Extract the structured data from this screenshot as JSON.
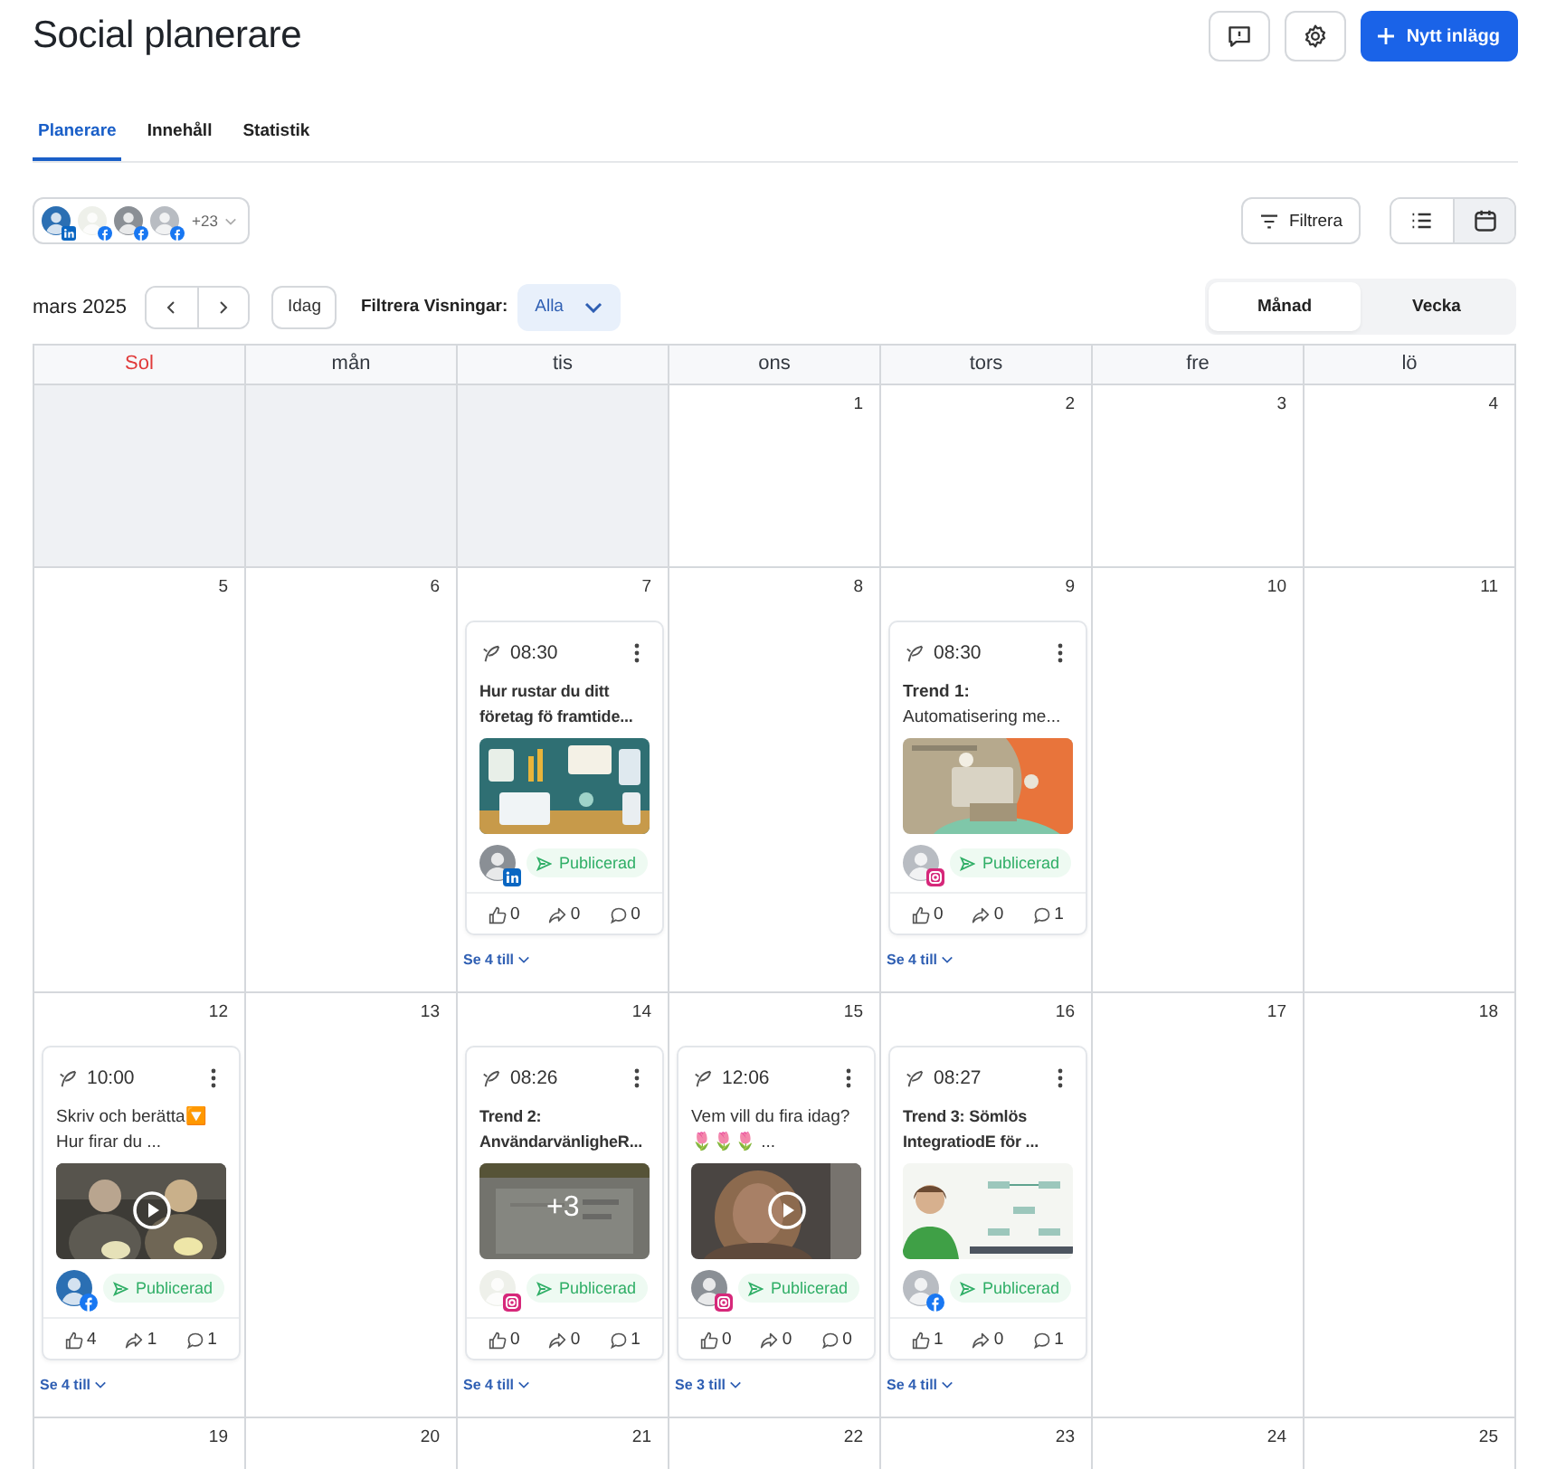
{
  "header": {
    "title": "Social planerare",
    "icon_buttons": [
      {
        "kind": "feedback"
      },
      {
        "kind": "settings"
      }
    ],
    "primary_button": "Nytt inlägg"
  },
  "tabs": [
    {
      "label": "Planerare",
      "selected": true
    },
    {
      "label": "Innehåll",
      "selected": false
    },
    {
      "label": "Statistik",
      "selected": false
    }
  ],
  "accounts": {
    "avatars": [
      {
        "kind": "linkedin"
      },
      {
        "kind": "facebook"
      },
      {
        "kind": "facebook"
      },
      {
        "kind": "facebook"
      }
    ],
    "more": "+23"
  },
  "filter_button": "Filtrera",
  "view_toggle": [
    {
      "kind": "list",
      "selected": false
    },
    {
      "kind": "calendar",
      "selected": true
    }
  ],
  "toolbar": {
    "month": "mars 2025",
    "today": "Idag",
    "filter_label": "Filtrera Visningar:",
    "filter_value": "Alla",
    "modes": [
      {
        "label": "Månad",
        "selected": true
      },
      {
        "label": "Vecka",
        "selected": false
      }
    ]
  },
  "weekdays": [
    {
      "label": "Sol",
      "color": "#e03a3a"
    },
    {
      "label": "mån",
      "color": "#333840"
    },
    {
      "label": "tis",
      "color": "#333840"
    },
    {
      "label": "ons",
      "color": "#333840"
    },
    {
      "label": "tors",
      "color": "#333840"
    },
    {
      "label": "fre",
      "color": "#333840"
    },
    {
      "label": "lö",
      "color": "#333840"
    }
  ],
  "weeks": [
    {
      "days": [
        {
          "outside": true
        },
        {
          "outside": true
        },
        {
          "outside": true
        },
        {
          "outside": false,
          "number": "1"
        },
        {
          "outside": false,
          "number": "2"
        },
        {
          "outside": false,
          "number": "3"
        },
        {
          "outside": false,
          "number": "4"
        }
      ]
    },
    {
      "days": [
        {
          "outside": false,
          "number": "5"
        },
        {
          "outside": false,
          "number": "6"
        },
        {
          "outside": false,
          "number": "7",
          "posts": [
            {
              "time": "08:30",
              "title": "Hur rustar du ditt företag fö framtide...",
              "bold": true,
              "kind": "linkedin",
              "status": "Publicerad",
              "likes": "0",
              "shares": "0",
              "comments": "0"
            }
          ],
          "more": "Se 4 till"
        },
        {
          "outside": false,
          "number": "8"
        },
        {
          "outside": false,
          "number": "9",
          "posts": [
            {
              "time": "08:30",
              "title": "**Trend 1:** Automatisering me...",
              "bold": false,
              "kind": "instagram",
              "status": "Publicerad",
              "likes": "0",
              "shares": "0",
              "comments": "1"
            }
          ],
          "more": "Se 4 till"
        },
        {
          "outside": false,
          "number": "10"
        },
        {
          "outside": false,
          "number": "11"
        }
      ]
    },
    {
      "days": [
        {
          "outside": false,
          "number": "12",
          "posts": [
            {
              "time": "10:00",
              "title": "Skriv och berätta🔽 Hur firar du ...",
              "bold": false,
              "media": {
                "kind": "video"
              },
              "kind": "facebook",
              "status": "Publicerad",
              "likes": "4",
              "shares": "1",
              "comments": "1"
            }
          ],
          "more": "Se 4 till"
        },
        {
          "outside": false,
          "number": "13"
        },
        {
          "outside": false,
          "number": "14",
          "posts": [
            {
              "time": "08:26",
              "title": "Trend 2: AnvändarvänligheR...",
              "bold": true,
              "media": {
                "overlay": "+3"
              },
              "kind": "instagram",
              "status": "Publicerad",
              "likes": "0",
              "shares": "0",
              "comments": "1"
            }
          ],
          "more": "Se 4 till"
        },
        {
          "outside": false,
          "number": "15",
          "posts": [
            {
              "time": "12:06",
              "title": "Vem vill du fira idag? 🌷🌷🌷 ...",
              "bold": false,
              "media": {
                "kind": "video"
              },
              "kind": "instagram",
              "status": "Publicerad",
              "likes": "0",
              "shares": "0",
              "comments": "0"
            }
          ],
          "more": "Se 3 till"
        },
        {
          "outside": false,
          "number": "16",
          "posts": [
            {
              "time": "08:27",
              "title": "Trend 3: Sömlös IntegratiodE för ...",
              "bold": true,
              "kind": "facebook",
              "status": "Publicerad",
              "likes": "1",
              "shares": "0",
              "comments": "1"
            }
          ],
          "more": "Se 4 till"
        },
        {
          "outside": false,
          "number": "17"
        },
        {
          "outside": false,
          "number": "18"
        }
      ]
    },
    {
      "days": [
        {
          "outside": false,
          "number": "19"
        },
        {
          "outside": false,
          "number": "20"
        },
        {
          "outside": false,
          "number": "21"
        },
        {
          "outside": false,
          "number": "22"
        },
        {
          "outside": false,
          "number": "23"
        },
        {
          "outside": false,
          "number": "24"
        },
        {
          "outside": false,
          "number": "25"
        }
      ]
    }
  ]
}
